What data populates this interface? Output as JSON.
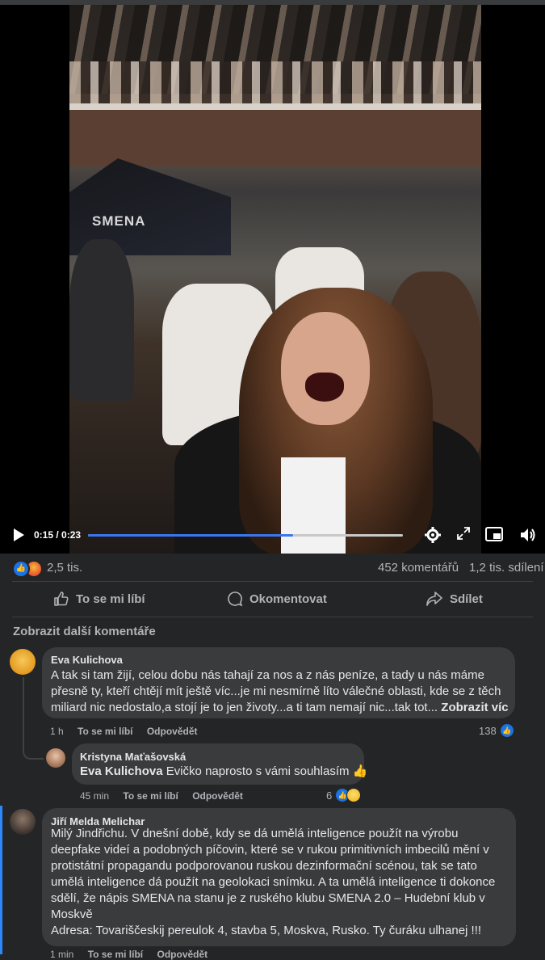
{
  "video": {
    "tent_label": "SMENA",
    "time": "0:15 / 0:23",
    "progress": 0.65,
    "accent": "#3a76f0"
  },
  "stats": {
    "reactions": "2,5 tis.",
    "comments": "452 komentářů",
    "shares": "1,2 tis. sdílení"
  },
  "actions": {
    "like": "To se mi líbí",
    "comment": "Okomentovat",
    "share": "Sdílet"
  },
  "more_comments": "Zobrazit další komentáře",
  "comments": [
    {
      "name": "Eva Kulichova",
      "lines": [
        "A tak si tam žijí, celou dobu nás tahají za nos a z nás peníze, a tady u nás máme",
        "přesně ty, kteří chtějí mít ještě víc...je mi nesmírně líto válečné oblasti, kde se z těch",
        "miliard nic nedostalo,a stojí je to jen životy...a ti tam nemají nic...tak tot..."
      ],
      "see_more": "Zobrazit víc",
      "time": "1 h",
      "like": "To se mi líbí",
      "reply": "Odpovědět",
      "reactions": "138"
    },
    {
      "name": "Kristyna Maťašovská",
      "mention": "Eva Kulichova",
      "text": "Evičko naprosto s vámi souhlasím 👍",
      "time": "45 min",
      "like": "To se mi líbí",
      "reply": "Odpovědět",
      "reactions": "6"
    },
    {
      "name": "Jiří Melda Melichar",
      "lines": [
        "Milý Jindřichu. V dnešní době, kdy se dá umělá inteligence použít na výrobu",
        "deepfake videí a podobných píčovin, které se v rukou primitivních imbecilů mění v",
        "protistátní propagandu podporovanou ruskou dezinformační scénou, tak se tato",
        "umělá inteligence dá použít na geolokaci snímku. A ta umělá inteligence ti dokonce",
        "sdělí, že nápis SMENA na stanu je z ruského klubu SMENA 2.0 – Hudební klub v",
        "Moskvě",
        "Adresa: Tovariščeskij pereulok 4, stavba 5, Moskva, Rusko. Ty čuráku ulhanej !!!"
      ],
      "time": "1 min",
      "like": "To se mi líbí",
      "reply": "Odpovědět"
    }
  ]
}
